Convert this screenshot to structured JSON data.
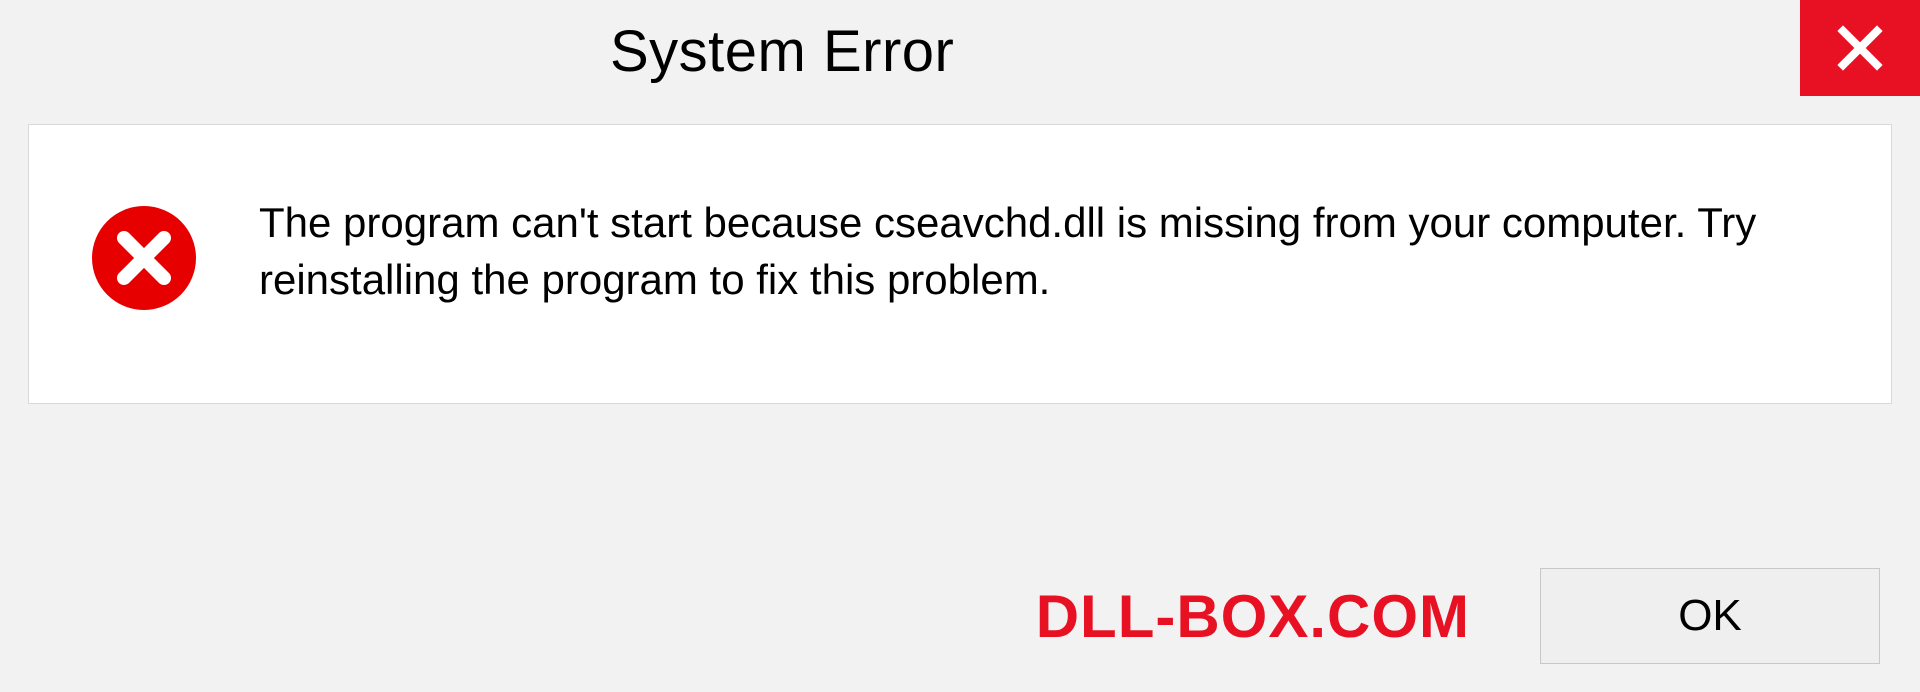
{
  "title": "System Error",
  "message": "The program can't start because cseavchd.dll is missing from your computer. Try reinstalling the program to fix this problem.",
  "buttons": {
    "ok": "OK"
  },
  "watermark": "DLL-BOX.COM",
  "colors": {
    "error_red": "#e81123"
  }
}
